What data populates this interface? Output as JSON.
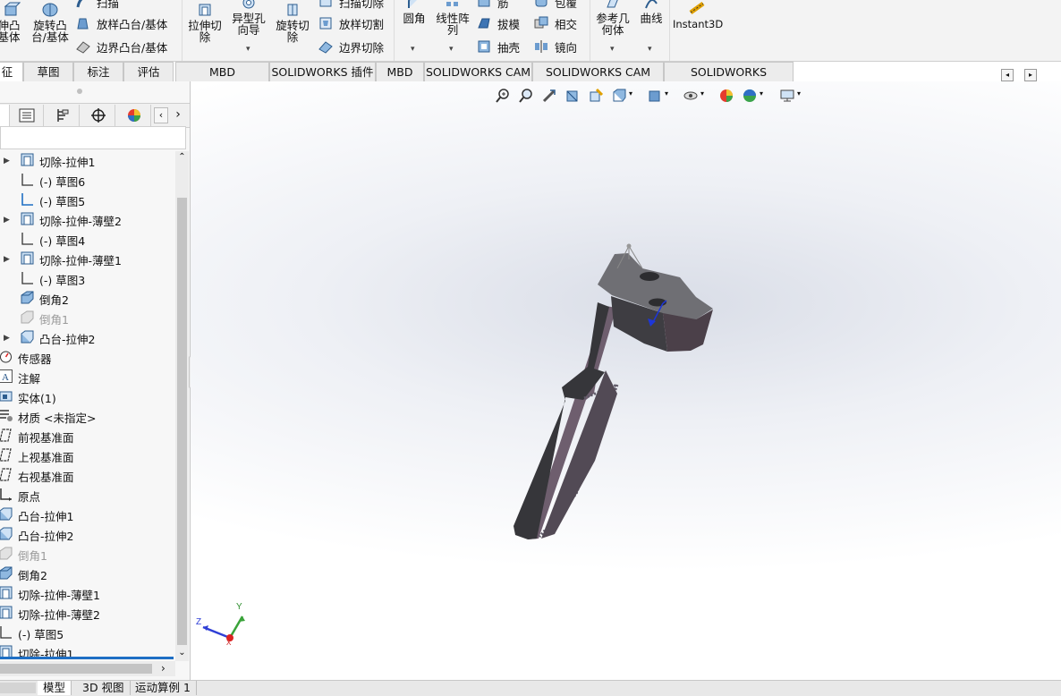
{
  "ribbon": {
    "boss_extrude": "伸凸\n基体",
    "revolve_boss": "旋转凸\n台/基体",
    "sweep": "扫描",
    "loft_boss": "放样凸台/基体",
    "boundary_boss": "边界凸台/基体",
    "extrude_cut": "拉伸切\n除",
    "hole_wizard": "异型孔\n向导",
    "revolve_cut": "旋转切\n除",
    "swept_cut": "扫描切除",
    "lofted_cut": "放样切割",
    "boundary_cut": "边界切除",
    "fillet": "圆角",
    "linear_pattern": "线性阵\n列",
    "rib": "筋",
    "draft": "拔模",
    "shell": "抽壳",
    "wrap": "包覆",
    "intersect": "相交",
    "mirror": "镜向",
    "ref_geometry": "参考几\n何体",
    "curves": "曲线",
    "instant3d": "Instant3D"
  },
  "tabs": [
    "征",
    "草图",
    "标注",
    "评估",
    "MBD Dimensions",
    "SOLIDWORKS 插件",
    "MBD",
    "SOLIDWORKS CAM",
    "SOLIDWORKS CAM TBM",
    "SOLIDWORKS Inspection"
  ],
  "tree": [
    {
      "label": "切除-拉伸1",
      "kind": "cut",
      "expand": true
    },
    {
      "label": "(-) 草图6",
      "kind": "sketch"
    },
    {
      "label": "(-) 草图5",
      "kind": "sketch-blue"
    },
    {
      "label": "切除-拉伸-薄壁2",
      "kind": "cut",
      "expand": true
    },
    {
      "label": "(-) 草图4",
      "kind": "sketch"
    },
    {
      "label": "切除-拉伸-薄壁1",
      "kind": "cut",
      "expand": true
    },
    {
      "label": "(-) 草图3",
      "kind": "sketch"
    },
    {
      "label": "倒角2",
      "kind": "chamfer"
    },
    {
      "label": "倒角1",
      "kind": "chamfer-grey",
      "grey": true
    },
    {
      "label": "凸台-拉伸2",
      "kind": "boss",
      "expand": true
    },
    {
      "label": "传感器",
      "kind": "sensor"
    },
    {
      "label": "注解",
      "kind": "annot"
    },
    {
      "label": "实体(1)",
      "kind": "solid"
    },
    {
      "label": "材质 <未指定>",
      "kind": "material"
    },
    {
      "label": "前视基准面",
      "kind": "plane"
    },
    {
      "label": "上视基准面",
      "kind": "plane"
    },
    {
      "label": "右视基准面",
      "kind": "plane"
    },
    {
      "label": "原点",
      "kind": "origin"
    },
    {
      "label": "凸台-拉伸1",
      "kind": "boss"
    },
    {
      "label": "凸台-拉伸2",
      "kind": "boss"
    },
    {
      "label": "倒角1",
      "kind": "chamfer-grey",
      "grey": true
    },
    {
      "label": "倒角2",
      "kind": "chamfer"
    },
    {
      "label": "切除-拉伸-薄壁1",
      "kind": "cut"
    },
    {
      "label": "切除-拉伸-薄壁2",
      "kind": "cut"
    },
    {
      "label": "(-) 草图5",
      "kind": "sketch"
    },
    {
      "label": "切除-拉伸1",
      "kind": "cut"
    }
  ],
  "bottom_tabs": [
    "模型",
    "3D 视图",
    "运动算例 1"
  ],
  "triad": {
    "x": "X",
    "y": "Y",
    "z": "Z"
  },
  "colors": {
    "accent": "#1f6fc4",
    "part": "#3a3a3e",
    "face_top": "#6b6b70"
  }
}
